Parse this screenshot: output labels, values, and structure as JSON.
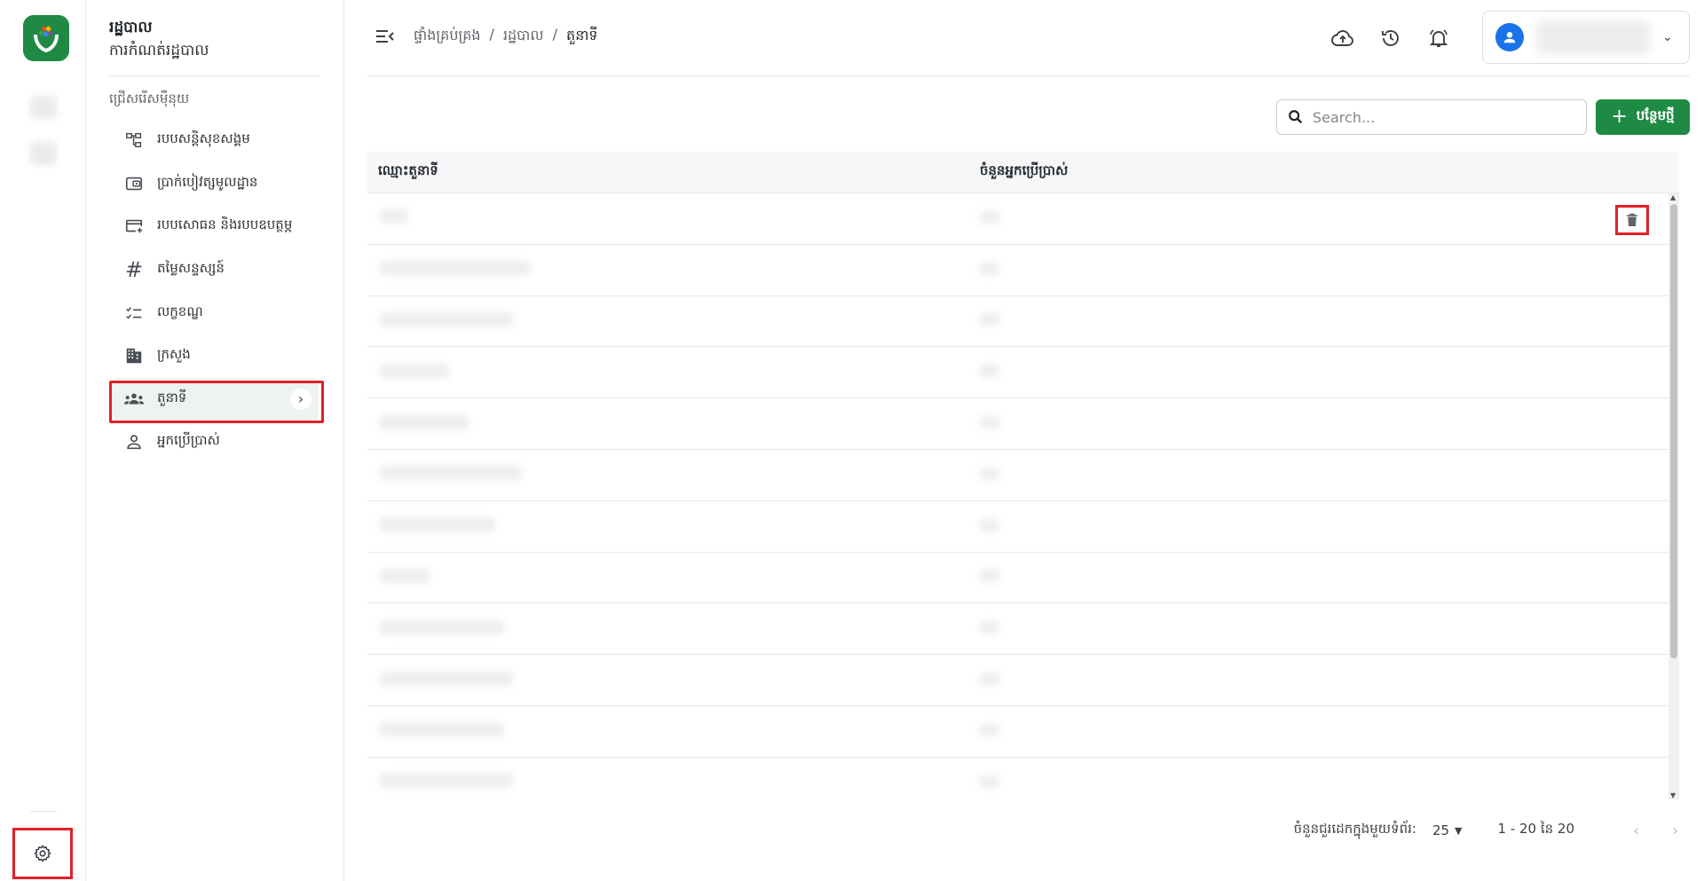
{
  "rail": {
    "logo": "app-logo",
    "settings_icon": "gear-icon"
  },
  "sidebar": {
    "title": "រដ្ឋបាល",
    "subtitle": "ការកំណត់រដ្ឋបាល",
    "section_label": "ជ្រើសរើសម៉ឺនុយ",
    "items": [
      {
        "label": "របបសន្តិសុខសង្គម",
        "icon": "hierarchy-icon",
        "active": false
      },
      {
        "label": "ប្រាក់បៀវត្សមូលដ្ឋាន",
        "icon": "wallet-icon",
        "active": false
      },
      {
        "label": "របបសោធន និងរបបឧបត្ថម្ភ",
        "icon": "card-add-icon",
        "active": false
      },
      {
        "label": "តម្លៃសន្ទស្សន៍",
        "icon": "hash-icon",
        "active": false
      },
      {
        "label": "លក្ខខណ្ឌ",
        "icon": "checklist-icon",
        "active": false
      },
      {
        "label": "ក្រសួង",
        "icon": "building-icon",
        "active": false
      },
      {
        "label": "តួនាទី",
        "icon": "group-icon",
        "active": true
      },
      {
        "label": "អ្នកប្រើប្រាស់",
        "icon": "person-icon",
        "active": false
      }
    ]
  },
  "topbar": {
    "breadcrumb": [
      "ផ្ទាំងគ្រប់គ្រង",
      "/",
      "រដ្ឋបាល",
      "/",
      "តួនាទី"
    ],
    "icons": [
      "cloud-upload-icon",
      "history-icon",
      "bell-icon"
    ]
  },
  "toolbar": {
    "search_placeholder": "Search...",
    "add_label": "បន្ថែមថ្មី"
  },
  "table": {
    "headers": [
      "ឈ្មោះតួនាទី",
      "ចំនួនអ្នកប្រើប្រាស់"
    ],
    "row_count": 12
  },
  "pagination": {
    "rows_per_page_label": "ចំនួនជួរដេកក្នុងមួយទំព័រ:",
    "rows_per_page": "25",
    "range": "1 - 20 នៃ 20"
  },
  "colors": {
    "brand": "#1e8a44",
    "highlight": "#e0202a",
    "avatar": "#1a73e8"
  }
}
